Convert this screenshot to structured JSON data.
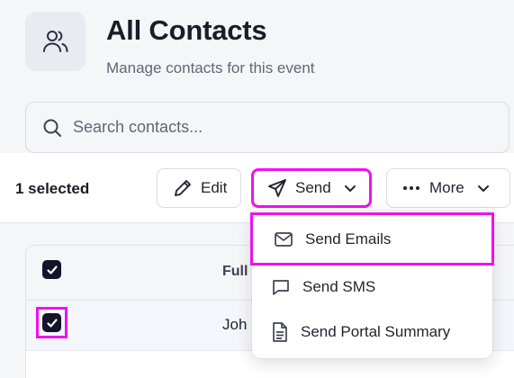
{
  "header": {
    "icon": "users-icon",
    "title": "All Contacts",
    "subtitle": "Manage contacts for this event"
  },
  "search": {
    "icon": "search-icon",
    "placeholder": "Search contacts..."
  },
  "bulk_bar": {
    "selected_text": "1 selected",
    "edit": {
      "label": "Edit",
      "icon": "pencil-icon"
    },
    "send": {
      "label": "Send",
      "icon": "send-icon",
      "chevron": "chevron-down-icon",
      "highlighted": true
    },
    "more": {
      "label": "More",
      "icon": "more-horizontal-icon",
      "chevron": "chevron-down-icon"
    }
  },
  "send_menu": {
    "items": [
      {
        "label": "Send Emails",
        "icon": "mail-icon",
        "highlighted": true
      },
      {
        "label": "Send SMS",
        "icon": "message-icon"
      },
      {
        "label": "Send Portal Summary",
        "icon": "document-icon"
      }
    ]
  },
  "table": {
    "header_checkbox_checked": true,
    "columns": [
      "Full"
    ],
    "rows": [
      {
        "checked": true,
        "highlighted": true,
        "name": "Joh"
      }
    ]
  },
  "colors": {
    "background": "#f5f6f8",
    "checkbox": "#12142a",
    "highlight": "#ee11ee",
    "text_primary": "#1a1d29",
    "text_secondary": "#5f6778"
  }
}
